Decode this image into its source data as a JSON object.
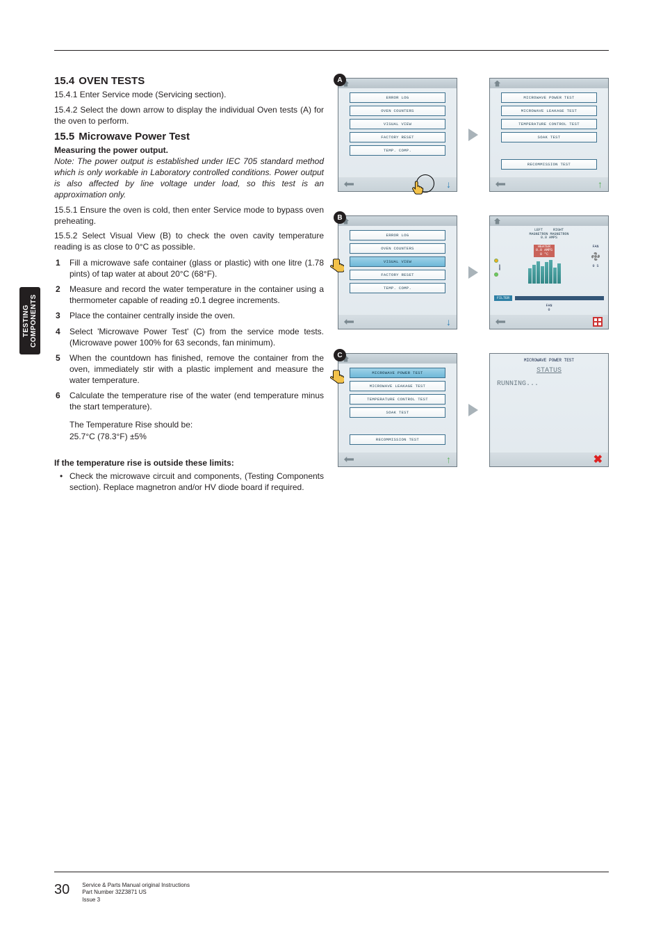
{
  "side_tab": "TESTING\nCOMPONENTS",
  "sec154": {
    "num": "15.4",
    "title": "OVEN TESTS",
    "p1": "15.4.1  Enter Service mode (Servicing section).",
    "p2": "15.4.2  Select the down arrow to display the individual Oven tests (A) for the oven to perform."
  },
  "sec155": {
    "num": "15.5",
    "title": "Microwave Power Test",
    "sub": "Measuring the power output.",
    "note": "Note: The power output is established under IEC 705 standard method which is only workable in Laboratory controlled conditions. Power output is also affected by line voltage under load, so this test is an approximation only.",
    "p1": "15.5.1  Ensure the oven is cold, then enter Service mode to bypass oven preheating.",
    "p2": "15.5.2  Select Visual View (B) to check the oven cavity temperature reading is as close to 0°C as possible.",
    "steps": [
      "Fill a microwave safe container (glass or plastic) with one litre (1.78 pints) of tap water at about 20°C (68°F).",
      "Measure and record the water temperature in the container using a thermometer capable of reading ±0.1 degree increments.",
      "Place the container centrally inside the oven.",
      "Select 'Microwave Power Test' (C) from the service mode tests. (Microwave power 100% for 63 seconds, fan minimum).",
      "When the countdown has finished, remove the container from the oven, immediately stir with a plastic implement and measure the water temperature.",
      "Calculate the temperature rise of the water (end temperature minus the start temperature)."
    ],
    "result1": "The Temperature Rise should be:",
    "result2": "25.7°C (78.3°F) ±5%",
    "limits_head": "If the temperature rise is outside these limits:",
    "bullet": "Check the microwave circuit and components, (Testing Components section). Replace magnetron and/or HV diode board if required."
  },
  "figA": {
    "label": "A",
    "left_items": [
      "ERROR LOG",
      "OVEN COUNTERS",
      "VISUAL VIEW",
      "FACTORY RESET",
      "TEMP. COMP."
    ],
    "right_items": [
      "MICROWAVE POWER TEST",
      "MICROWAVE LEAKAGE TEST",
      "TEMPERATURE CONTROL TEST",
      "SOAK TEST",
      "RECOMMISSION TEST"
    ]
  },
  "figB": {
    "label": "B",
    "left_items": [
      "ERROR LOG",
      "OVEN COUNTERS",
      "VISUAL VIEW",
      "FACTORY RESET",
      "TEMP. COMP."
    ],
    "highlight_index": 2,
    "vv": {
      "title_top": "LEFT     RIGHT\nMAGNETRON MAGNETRON\n0.0 AMPS",
      "door": "DOOR",
      "heater": "HEATER\n0.0 AMPS\n0 °C",
      "fan": "FAN",
      "filter": "FILTER",
      "fan_bot": "FAN\n0",
      "zero_s": "0 S"
    }
  },
  "figC": {
    "label": "C",
    "left_items": [
      "MICROWAVE POWER TEST",
      "MICROWAVE LEAKAGE TEST",
      "TEMPERATURE CONTROL TEST",
      "SOAK TEST",
      "RECOMMISSION TEST"
    ],
    "highlight_index": 0,
    "run": {
      "title": "MICROWAVE POWER TEST",
      "status_label": "STATUS",
      "running": "RUNNING..."
    }
  },
  "footer": {
    "page": "30",
    "l1": "Service & Parts Manual original Instructions",
    "l2": "Part Number 32Z3871 US",
    "l3": "Issue 3"
  }
}
